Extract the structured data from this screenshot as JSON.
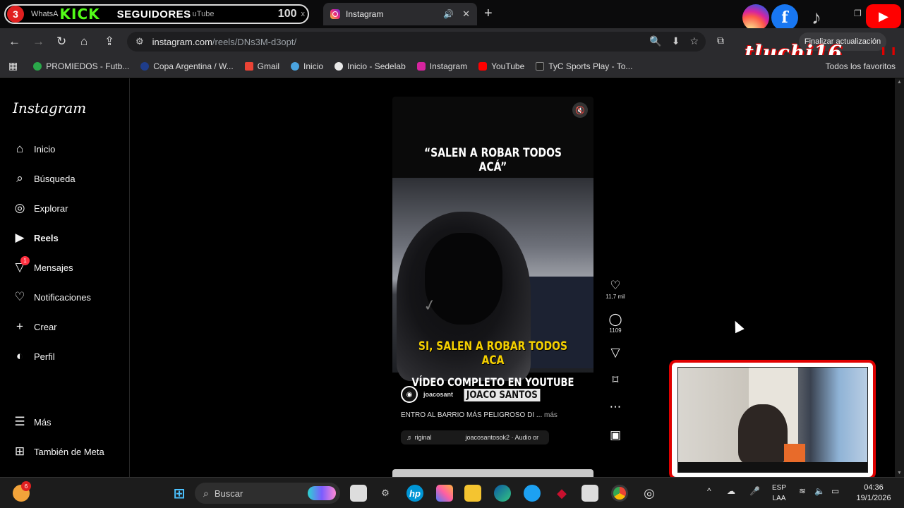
{
  "tabs": {
    "overlay_badge": "3",
    "whatsapp_fragment": "WhatsA",
    "kick_logo": "KICK",
    "followers_label": "SEGUIDORES",
    "youtube_fragment": "uTube",
    "followers_count": "100",
    "close_small": "x",
    "active_title": "Instagram",
    "speaker_icon": "speaker-icon",
    "new_tab": "+"
  },
  "overlay_socials": {
    "facebook": "f",
    "tiktok": "♪",
    "youtube": "▶"
  },
  "address_bar": {
    "host": "instagram.com",
    "path": "/reels/DNs3M-d3opt/",
    "update_button": "Finalizar actualización"
  },
  "streamer": {
    "name": "tluchi16",
    "bars": "| |"
  },
  "bookmarks": {
    "items": [
      {
        "label": "PROMIEDOS - Futb...",
        "color": "#2aa84a"
      },
      {
        "label": "Copa Argentina / W...",
        "color": "#1f3d8a"
      },
      {
        "label": "Gmail",
        "color": "#ea4335"
      },
      {
        "label": "Inicio",
        "color": "#4aa3df"
      },
      {
        "label": "Inicio - Sedelab",
        "color": "#e8e8e8"
      },
      {
        "label": "Instagram",
        "color": "#d6249f"
      },
      {
        "label": "YouTube",
        "color": "#ff0000"
      },
      {
        "label": "TyC Sports Play - To...",
        "color": "#222222"
      }
    ],
    "all_favorites": "Todos los favoritos"
  },
  "instagram": {
    "logo": "Instagram",
    "nav": {
      "home": "Inicio",
      "search": "Búsqueda",
      "explore": "Explorar",
      "reels": "Reels",
      "messages": "Mensajes",
      "messages_badge": "1",
      "notifications": "Notificaciones",
      "create": "Crear",
      "profile": "Perfil",
      "more": "Más",
      "meta": "También de Meta"
    },
    "reel": {
      "quote": "“SALEN A ROBAR TODOS ACÁ”",
      "caption": "SI, SALEN A ROBAR TODOS ACA",
      "video_title": "VÍDEO COMPLETO EN YOUTUBE",
      "username": "joacosant",
      "name_tag": "JOACO SANTOS",
      "description": "ENTRO AL BARRIO MÁS PELIGROSO DI ...",
      "more": "más",
      "audio_left": "♬ riginal",
      "audio_right": "joacosantosok2 · Audio or"
    },
    "actions": {
      "likes": "11,7 mil",
      "comments": "1109"
    }
  },
  "taskbar": {
    "weather_badge": "6",
    "search_placeholder": "Buscar",
    "language": "ESP",
    "layout": "LAA",
    "time": "04:36",
    "date": "19/1/2026"
  },
  "colors": {
    "accent_red": "#e00000",
    "instagram_notification": "#ff3040",
    "kick_green": "#53fc18",
    "reel_caption_yellow": "#f5d000"
  }
}
